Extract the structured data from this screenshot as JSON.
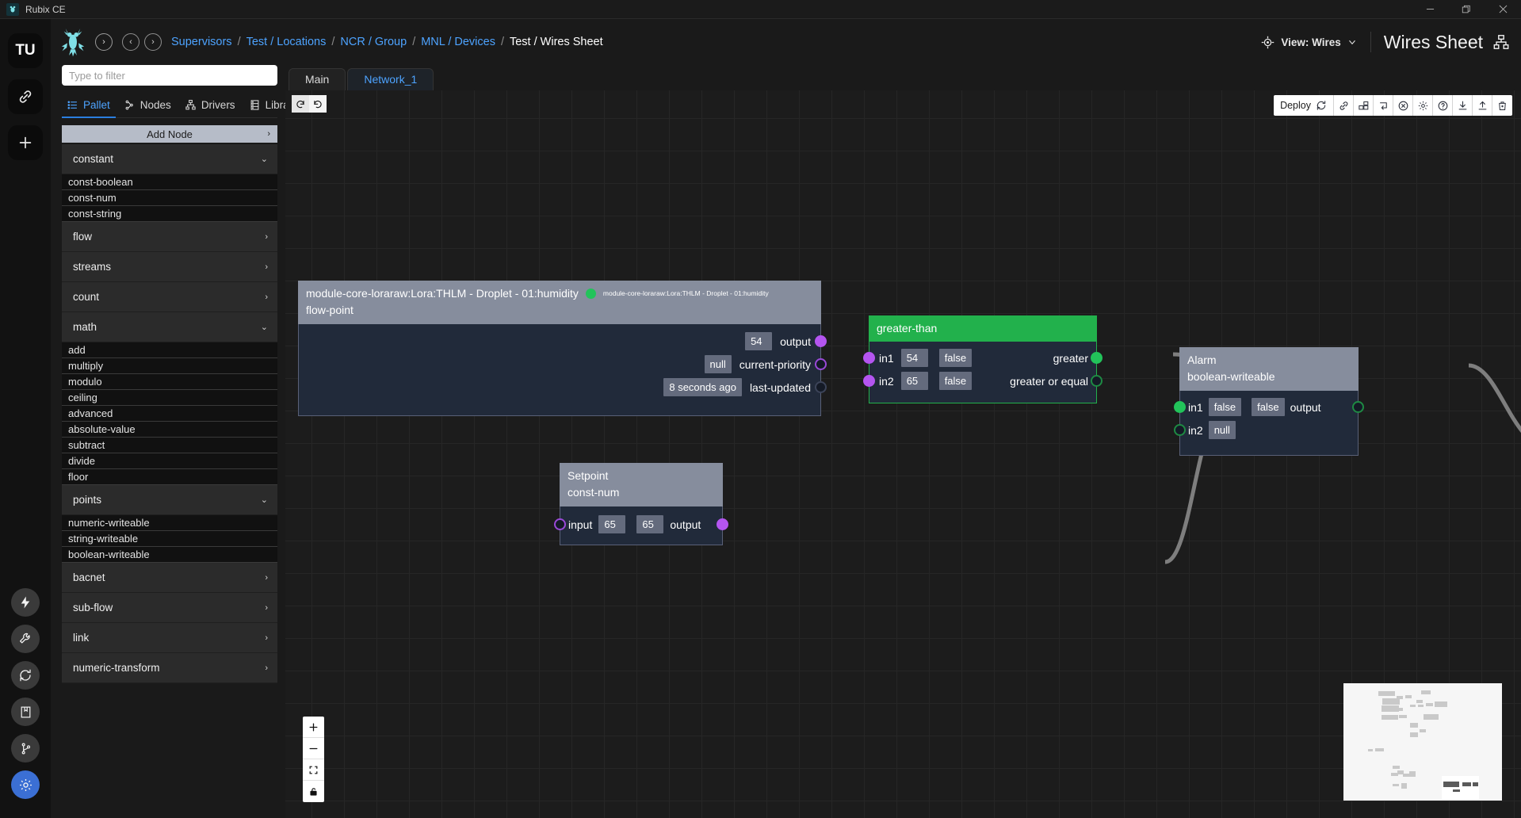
{
  "window": {
    "app_title": "Rubix CE",
    "app_icon": "frog-icon",
    "minimize": "minimize-icon",
    "maximize": "maximize-icon",
    "close": "close-icon"
  },
  "rail": {
    "top_items": [
      {
        "label": "TU",
        "name": "user-avatar-tu"
      },
      {
        "label": "",
        "name": "link-icon"
      },
      {
        "label": "",
        "name": "add-icon"
      }
    ],
    "bottom_items": [
      {
        "name": "lightning-icon"
      },
      {
        "name": "wrench-icon"
      },
      {
        "name": "refresh-icon"
      },
      {
        "name": "book-icon"
      },
      {
        "name": "git-branch-icon"
      },
      {
        "name": "gear-icon",
        "active": true
      }
    ]
  },
  "header": {
    "back_label": "‹",
    "forward_label": "›",
    "collapse_label": "›",
    "breadcrumbs": [
      {
        "label": "Supervisors",
        "active": false
      },
      {
        "label": "Test / Locations",
        "active": false
      },
      {
        "label": "NCR / Group",
        "active": false
      },
      {
        "label": "MNL / Devices",
        "active": false
      },
      {
        "label": "Test / Wires Sheet",
        "active": true
      }
    ],
    "separator": "/",
    "view_selector": "View: Wires",
    "view_icon": "target-icon",
    "view_chevron": "chevron-down-icon",
    "sheet_title": "Wires Sheet",
    "sheet_icon": "sitemap-icon"
  },
  "sidebar": {
    "filter_placeholder": "Type to filter",
    "filter_value": "",
    "tabs": [
      {
        "label": "Pallet",
        "icon": "list-icon",
        "active": true
      },
      {
        "label": "Nodes",
        "icon": "nodes-icon",
        "active": false
      },
      {
        "label": "Drivers",
        "icon": "sitemap-icon",
        "active": false
      },
      {
        "label": "Library",
        "icon": "library-icon",
        "active": false
      }
    ],
    "add_node_label": "Add Node",
    "add_node_chevron": "chevron-right-icon",
    "groups": [
      {
        "label": "constant",
        "expanded": true,
        "chevron": "chevron-down-icon",
        "items": [
          "const-boolean",
          "const-num",
          "const-string"
        ]
      },
      {
        "label": "flow",
        "expanded": false,
        "chevron": "chevron-right-icon",
        "items": []
      },
      {
        "label": "streams",
        "expanded": false,
        "chevron": "chevron-right-icon",
        "items": []
      },
      {
        "label": "count",
        "expanded": false,
        "chevron": "chevron-right-icon",
        "items": []
      },
      {
        "label": "math",
        "expanded": true,
        "chevron": "chevron-down-icon",
        "items": [
          "add",
          "multiply",
          "modulo",
          "ceiling",
          "advanced",
          "absolute-value",
          "subtract",
          "divide",
          "floor"
        ]
      },
      {
        "label": "points",
        "expanded": true,
        "chevron": "chevron-down-icon",
        "items": [
          "numeric-writeable",
          "string-writeable",
          "boolean-writeable"
        ]
      },
      {
        "label": "bacnet",
        "expanded": false,
        "chevron": "chevron-right-icon",
        "items": []
      },
      {
        "label": "sub-flow",
        "expanded": false,
        "chevron": "chevron-right-icon",
        "items": []
      },
      {
        "label": "link",
        "expanded": false,
        "chevron": "chevron-right-icon",
        "items": []
      },
      {
        "label": "numeric-transform",
        "expanded": false,
        "chevron": "chevron-right-icon",
        "items": []
      }
    ]
  },
  "sheet": {
    "tabs": [
      {
        "label": "Main",
        "active": false
      },
      {
        "label": "Network_1",
        "active": true
      }
    ],
    "undo_icon": "undo-icon",
    "redo_icon": "redo-icon"
  },
  "toolbar": {
    "deploy_label": "Deploy",
    "deploy_icon": "refresh-icon",
    "icons": [
      "link-icon",
      "duplicate-icon",
      "undo-arrow-icon",
      "cancel-icon",
      "gear-icon",
      "help-icon",
      "download-icon",
      "upload-icon",
      "trash-icon"
    ]
  },
  "nodes": [
    {
      "id": "flow-point",
      "title": "module-core-loraraw:Lora:THLM - Droplet - 01:humidity",
      "subtitle": "flow-point",
      "badge_text": "module-core-loraraw:Lora:THLM - Droplet - 01:humidity",
      "status_dot": "green",
      "outputs": [
        {
          "label": "output",
          "value": "54",
          "port": "pur-fill"
        },
        {
          "label": "current-priority",
          "value": "null",
          "port": "pur-open"
        },
        {
          "label": "last-updated",
          "value": "8 seconds ago",
          "port": "dark-open"
        }
      ]
    },
    {
      "id": "greater-than",
      "title": "greater-than",
      "header_color": "#22b14c",
      "inputs": [
        {
          "label": "in1",
          "value": "54",
          "port": "pur-fill"
        },
        {
          "label": "in2",
          "value": "65",
          "port": "pur-fill"
        }
      ],
      "outputs": [
        {
          "label": "greater",
          "value": "false",
          "port": "grn-fill"
        },
        {
          "label": "greater or equal",
          "value": "false",
          "port": "grn-open"
        }
      ]
    },
    {
      "id": "alarm",
      "title": "Alarm",
      "subtitle": "boolean-writeable",
      "inputs": [
        {
          "label": "in1",
          "value": "false",
          "port": "grn-fill"
        },
        {
          "label": "in2",
          "value": "null",
          "port": "grn-open"
        }
      ],
      "outputs": [
        {
          "label": "output",
          "value": "false",
          "port": "grn-open"
        }
      ]
    },
    {
      "id": "setpoint",
      "title": "Setpoint",
      "subtitle": "const-num",
      "inputs": [
        {
          "label": "input",
          "value": "65",
          "port": "pur-open"
        }
      ],
      "outputs": [
        {
          "label": "output",
          "value": "65",
          "port": "pur-fill"
        }
      ]
    }
  ],
  "zoom_controls": {
    "zoom_in": "plus-icon",
    "zoom_out": "minus-icon",
    "fit_view": "fit-icon",
    "lock": "lock-icon"
  },
  "colors": {
    "accent_blue": "#4da3ff",
    "node_green": "#22b14c",
    "node_header_gray": "#868d9d",
    "node_body": "#212a3a",
    "port_purple": "#b455f0",
    "port_green": "#22c35a",
    "canvas_bg": "#1c1c1c"
  }
}
